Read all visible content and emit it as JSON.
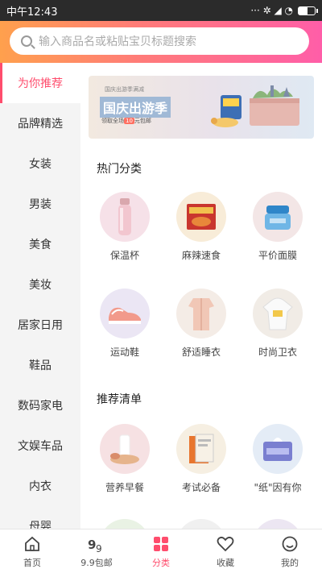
{
  "status_bar": {
    "time": "中午12:43",
    "indicators": "··· ✲ ◢ ◔"
  },
  "search": {
    "placeholder": "输入商品名或粘贴宝贝标题搜索"
  },
  "sidebar": {
    "items": [
      {
        "label": "为你推荐",
        "active": true
      },
      {
        "label": "品牌精选"
      },
      {
        "label": "女装"
      },
      {
        "label": "男装"
      },
      {
        "label": "美食"
      },
      {
        "label": "美妆"
      },
      {
        "label": "居家日用"
      },
      {
        "label": "鞋品"
      },
      {
        "label": "数码家电"
      },
      {
        "label": "文娱车品"
      },
      {
        "label": "内衣"
      },
      {
        "label": "母婴"
      }
    ]
  },
  "banner": {
    "small": "国庆出游季满减",
    "title": "国庆出游季",
    "sub_prefix": "领取全场",
    "sub_badge": "10",
    "sub_suffix": "元包邮"
  },
  "hot": {
    "title": "热门分类",
    "items": [
      {
        "label": "保温杯",
        "bg": "#f6e1e8",
        "icon": "thermos-bottle"
      },
      {
        "label": "麻辣速食",
        "bg": "#f8ecd8",
        "icon": "spicy-noodle-pack"
      },
      {
        "label": "平价面膜",
        "bg": "#f3e6e6",
        "icon": "face-mask-jar"
      },
      {
        "label": "运动鞋",
        "bg": "#ebe6f4",
        "icon": "sneaker"
      },
      {
        "label": "舒适睡衣",
        "bg": "#f4ece6",
        "icon": "pajamas"
      },
      {
        "label": "时尚卫衣",
        "bg": "#f1ece6",
        "icon": "hoodie"
      }
    ]
  },
  "recommend": {
    "title": "推荐清单",
    "items": [
      {
        "label": "营养早餐",
        "bg": "#f6e1e3",
        "icon": "milk-breakfast"
      },
      {
        "label": "考试必备",
        "bg": "#f6efe2",
        "icon": "exam-books"
      },
      {
        "label": "\"纸\"因有你",
        "bg": "#e4ecf6",
        "icon": "tissue-box"
      }
    ]
  },
  "bottom_nav": {
    "items": [
      {
        "label": "首页",
        "icon": "home-icon"
      },
      {
        "label": "9.9包邮",
        "icon": "ninety-nine-icon"
      },
      {
        "label": "分类",
        "icon": "category-icon",
        "active": true
      },
      {
        "label": "收藏",
        "icon": "heart-icon"
      },
      {
        "label": "我的",
        "icon": "user-icon"
      }
    ]
  },
  "colors": {
    "accent": "#ff4d6d",
    "header_start": "#ffa04d",
    "header_end": "#ff5ea8"
  }
}
